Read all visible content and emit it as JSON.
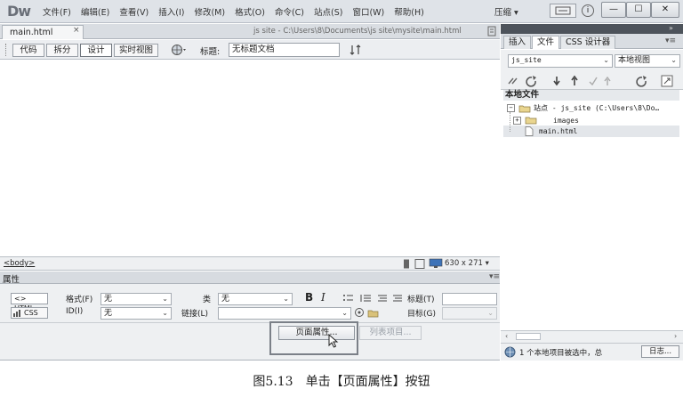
{
  "app": {
    "logo": "Dw",
    "layout_switch": "压缩 ▾"
  },
  "menu": [
    "文件(F)",
    "编辑(E)",
    "查看(V)",
    "插入(I)",
    "修改(M)",
    "格式(O)",
    "命令(C)",
    "站点(S)",
    "窗口(W)",
    "帮助(H)"
  ],
  "window_buttons": {
    "minimize": "—",
    "maximize": "☐",
    "close": "✕"
  },
  "document": {
    "tab_name": "main.html",
    "tab_close": "×",
    "path": "js site - C:\\Users\\8\\Documents\\js site\\mysite\\main.html"
  },
  "doc_toolbar": {
    "code": "代码",
    "split": "拆分",
    "design": "设计",
    "live_view": "实时视图",
    "title_label": "标题:",
    "title_value": "无标题文档"
  },
  "status_bar": {
    "tag": "<body>",
    "window_size": "630 x 271 ▾"
  },
  "properties": {
    "title": "属性",
    "html_button": "<> HTML",
    "css_button": "CSS",
    "format_label": "格式(F)",
    "format_value": "无",
    "class_label": "类",
    "class_value": "无",
    "id_label": "ID(I)",
    "id_value": "无",
    "link_label": "链接(L)",
    "link_value": "",
    "bold": "B",
    "italic": "I",
    "title_label": "标题(T)",
    "target_label": "目标(G)",
    "page_props_button": "页面属性...",
    "list_item_button": "列表项目..."
  },
  "right_panel": {
    "tabs": [
      "插入",
      "文件",
      "CSS 设计器"
    ],
    "site_select": "js_site",
    "view_select": "本地视图",
    "local_files_header": "本地文件",
    "tree": [
      {
        "label": "站点 - js_site (C:\\Users\\8\\Do…"
      },
      {
        "label": "images"
      },
      {
        "label": "main.html"
      }
    ],
    "status": "1 个本地项目被选中，总",
    "log_button": "日志..."
  },
  "caption": "图5.13　单击【页面属性】按钮"
}
